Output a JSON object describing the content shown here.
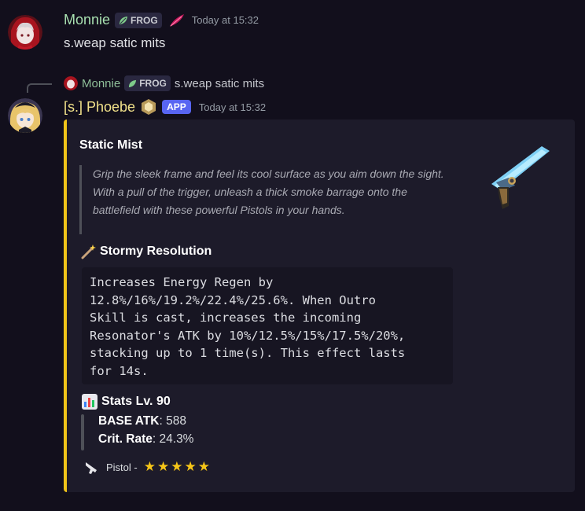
{
  "message1": {
    "author": "Monnie",
    "tag": "FROG",
    "timestamp": "Today at 15:32",
    "content": "s.weap satic mits"
  },
  "reply": {
    "author": "Monnie",
    "tag": "FROG",
    "content": "s.weap satic mits"
  },
  "message2": {
    "author": "[s.] Phoebe",
    "app_badge": "APP",
    "timestamp": "Today at 15:32"
  },
  "embed": {
    "accent_color": "#f0c419",
    "title": "Static Mist",
    "description": "Grip the sleek frame and feel its cool surface as you aim down the sight. With a pull of the trigger, unleash a thick smoke barrage onto the battlefield with these powerful Pistols in your hands.",
    "passive_title": "Stormy Resolution",
    "passive_icon": "magic-wand-icon",
    "passive_text": "Increases Energy Regen by\n12.8%/16%/19.2%/22.4%/25.6%. When Outro\nSkill is cast, increases the incoming\nResonator's ATK by 10%/12.5%/15%/17.5%/20%,\nstacking up to 1 time(s). This effect lasts\nfor 14s.",
    "stats_title": "Stats Lv. 90",
    "stats_icon": "bar-chart-icon",
    "stats": [
      {
        "label": "BASE ATK",
        "value": ": 588"
      },
      {
        "label": "Crit. Rate",
        "value": ": 24.3%"
      }
    ],
    "footer_text": "Pistol - ",
    "footer_icon": "pistol-icon",
    "rarity_stars": 5
  }
}
